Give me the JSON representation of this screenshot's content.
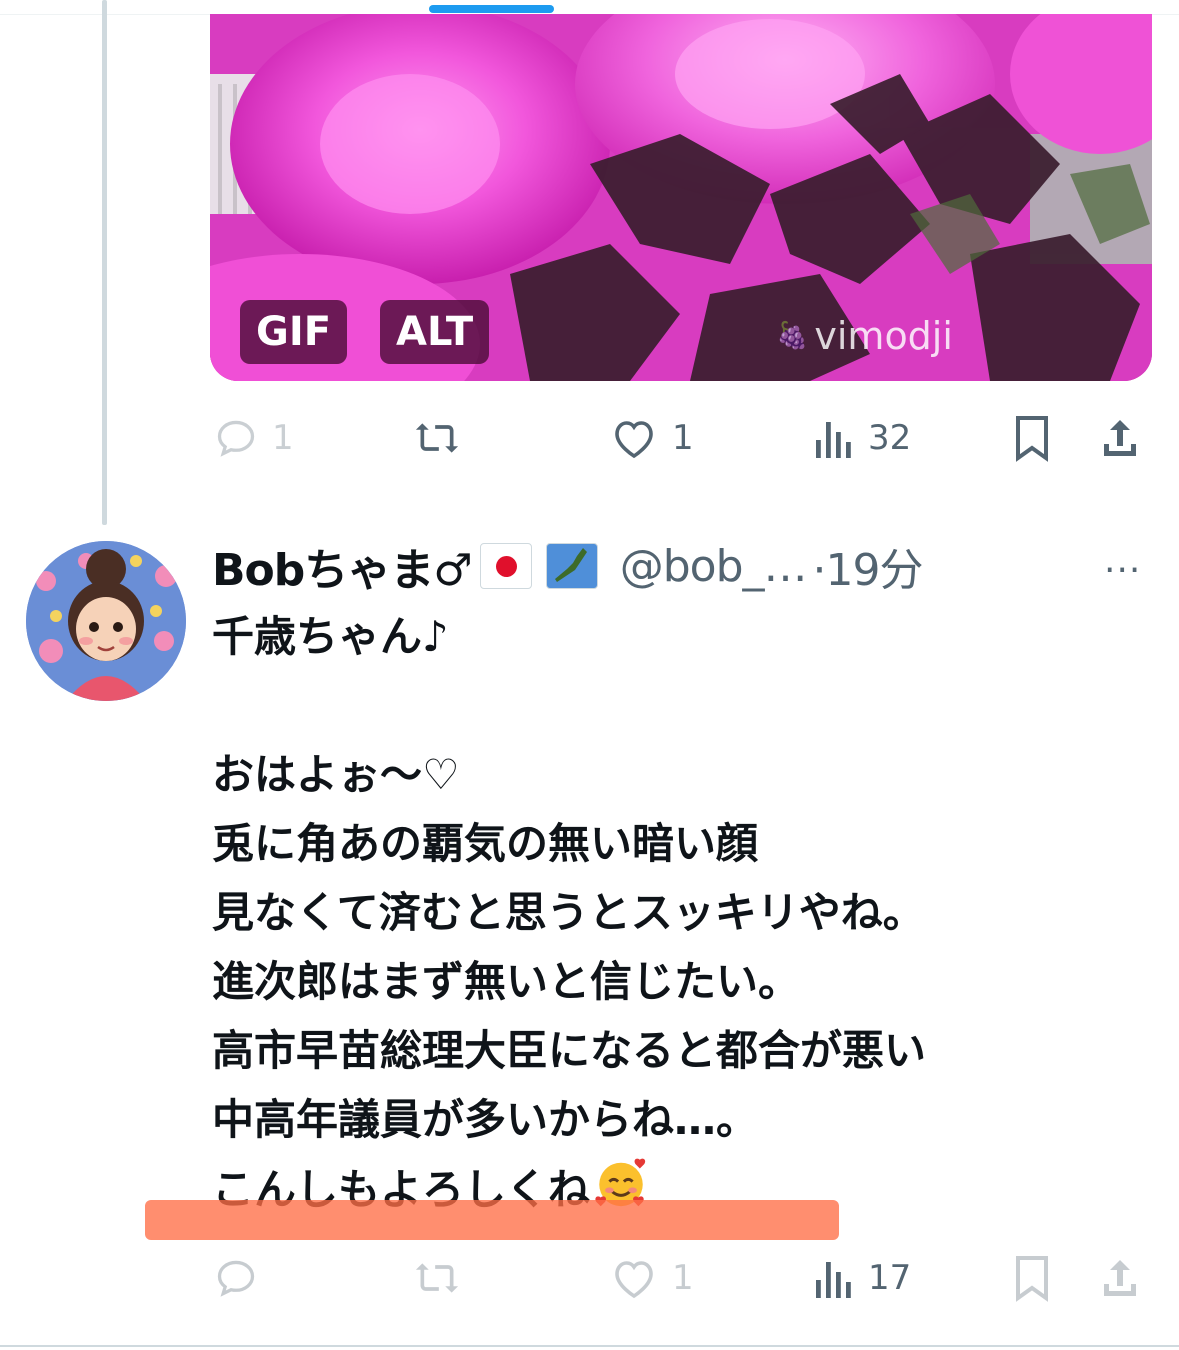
{
  "media": {
    "gif_badge": "GIF",
    "alt_badge": "ALT",
    "watermark": "vimodji"
  },
  "prev_actions": {
    "reply_count": "1",
    "like_count": "1",
    "views_count": "32"
  },
  "tweet": {
    "author_name": "Bobちゃま♂",
    "handle": "@bob_…",
    "time": "·19分",
    "more": "···",
    "lines": [
      "千歳ちゃん♪",
      "",
      "おはよぉ〜♡",
      "兎に角あの覇気の無い暗い顔",
      "見なくて済むと思うとスッキリやね。",
      "進次郎はまず無いと信じたい。",
      "高市早苗総理大臣になると都合が悪い",
      "中高年議員が多いからね…。",
      "こんしもよろしくね"
    ],
    "actions": {
      "reply_count": "",
      "like_count": "1",
      "views_count": "17"
    }
  },
  "colors": {
    "accent": "#1d9bf0",
    "icon_gray": "#536471",
    "text": "#0f1419",
    "highlight": "#ff8a66"
  }
}
